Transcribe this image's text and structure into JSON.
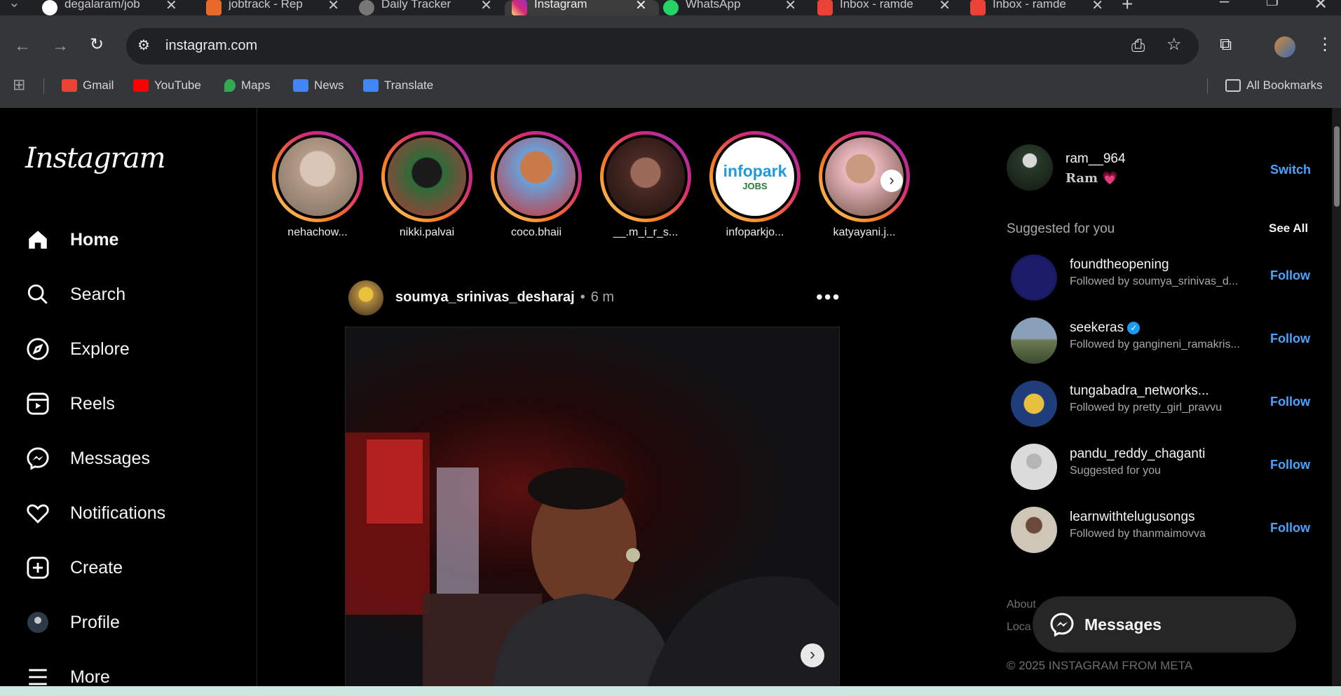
{
  "browser": {
    "tabs": [
      {
        "title": "degalaram/job",
        "icon": "github-icon"
      },
      {
        "title": "jobtrack - Rep",
        "icon": "jobtrack-icon"
      },
      {
        "title": "Daily Tracker",
        "icon": "globe-icon"
      },
      {
        "title": "Instagram",
        "icon": "instagram-icon",
        "active": true
      },
      {
        "title": "WhatsApp",
        "icon": "whatsapp-icon"
      },
      {
        "title": "Inbox - ramde",
        "icon": "gmail-icon"
      },
      {
        "title": "Inbox - ramde",
        "icon": "gmail-icon"
      }
    ],
    "new_tab": "+",
    "url": "instagram.com",
    "bookmarks": [
      {
        "label": "Gmail",
        "icon": "gmail-icon"
      },
      {
        "label": "YouTube",
        "icon": "youtube-icon"
      },
      {
        "label": "Maps",
        "icon": "maps-icon"
      },
      {
        "label": "News",
        "icon": "news-icon"
      },
      {
        "label": "Translate",
        "icon": "translate-icon"
      }
    ],
    "all_bookmarks": "All Bookmarks"
  },
  "instagram": {
    "logo": "Instagram",
    "nav": [
      {
        "label": "Home",
        "icon": "home-icon",
        "active": true
      },
      {
        "label": "Search",
        "icon": "search-icon"
      },
      {
        "label": "Explore",
        "icon": "explore-icon"
      },
      {
        "label": "Reels",
        "icon": "reels-icon"
      },
      {
        "label": "Messages",
        "icon": "messenger-icon"
      },
      {
        "label": "Notifications",
        "icon": "heart-icon"
      },
      {
        "label": "Create",
        "icon": "create-icon"
      },
      {
        "label": "Profile",
        "icon": "avatar"
      },
      {
        "label": "More",
        "icon": "menu-icon"
      }
    ],
    "stories": [
      {
        "username": "nehachow...",
        "color": "#b39b86"
      },
      {
        "username": "nikki.palvai",
        "color": "#2f6b3a"
      },
      {
        "username": "coco.bhaii",
        "color": "#c97a4a"
      },
      {
        "username": "__.m_i_r_s...",
        "color": "#4a2a24"
      },
      {
        "username": "infoparkjo...",
        "color": "#ffffff"
      },
      {
        "username": "katyayani.j...",
        "color": "#6a4a3a"
      }
    ],
    "infopark_logo": {
      "title": "infopark",
      "sub": "JOBS"
    },
    "post": {
      "username": "soumya_srinivas_desharaj",
      "separator": "•",
      "time": "6 m"
    },
    "me": {
      "username": "ram__964",
      "name": "Ram 💗",
      "switch": "Switch"
    },
    "suggested_title": "Suggested for you",
    "see_all": "See All",
    "suggestions": [
      {
        "username": "foundtheopening",
        "sub": "Followed by soumya_srinivas_d...",
        "follow": "Follow",
        "verified": false,
        "color": "#1c1c6b"
      },
      {
        "username": "seekeras",
        "sub": "Followed by gangineni_ramakris...",
        "follow": "Follow",
        "verified": true,
        "color": "#8aa0b8"
      },
      {
        "username": "tungabadra_networks...",
        "sub": "Followed by pretty_girl_pravvu",
        "follow": "Follow",
        "verified": false,
        "color": "#1e3d7a"
      },
      {
        "username": "pandu_reddy_chaganti",
        "sub": "Suggested for you",
        "follow": "Follow",
        "verified": false,
        "color": "#dbdbdb"
      },
      {
        "username": "learnwithtelugusongs",
        "sub": "Followed by thanmaimovva",
        "follow": "Follow",
        "verified": false,
        "color": "#cfc6b8"
      }
    ],
    "footer": {
      "about": "About",
      "locations": "Loca",
      "copyright": "© 2025 INSTAGRAM FROM META"
    },
    "messages_pill": "Messages",
    "accent": "#4aa3ff"
  }
}
